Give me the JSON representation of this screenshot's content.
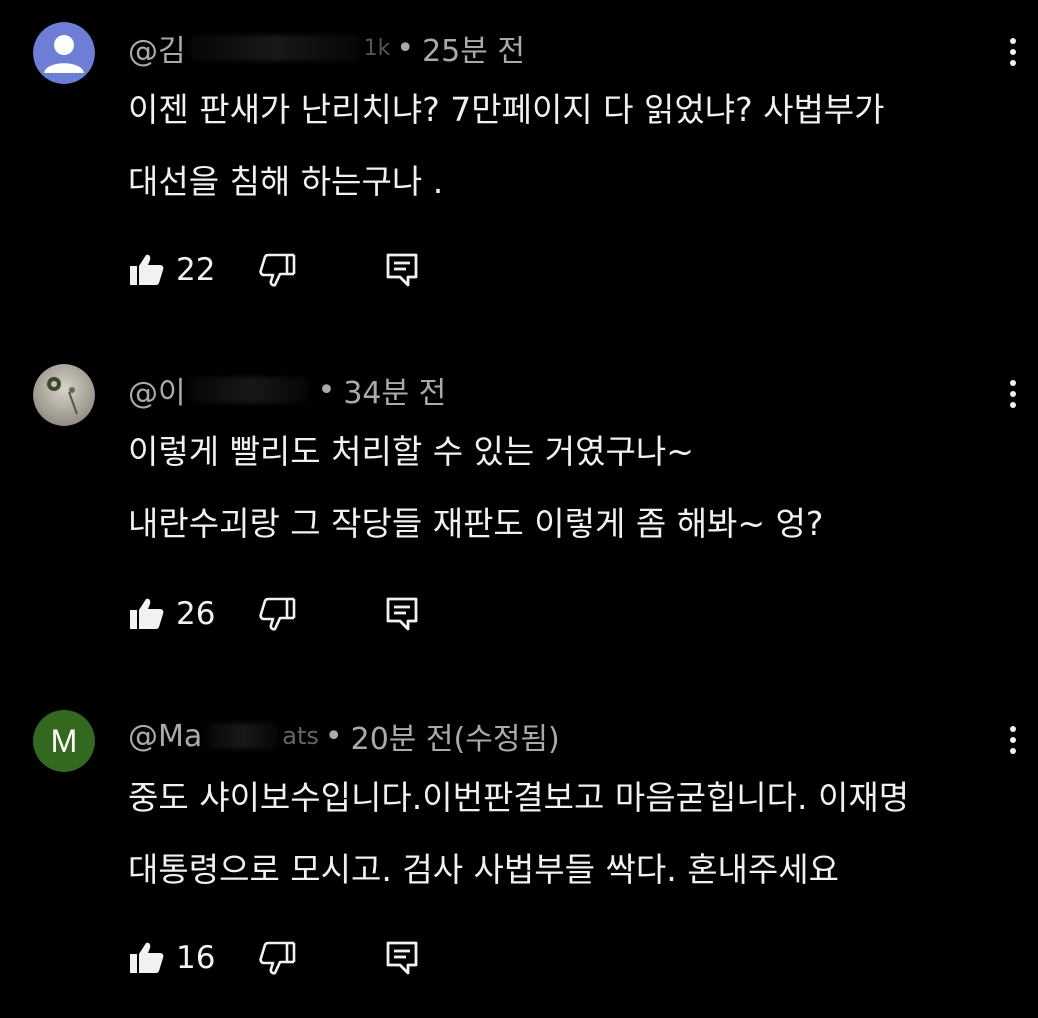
{
  "colors": {
    "background": "#000000",
    "text": "#f1f1f1",
    "meta": "#aaaaaa",
    "avatar_default": "#6d7ed6",
    "avatar_m": "#33691e"
  },
  "comments": [
    {
      "handle_visible": "@김",
      "handle_tail": "1k",
      "time": "25분 전",
      "lines": [
        "이젠 판새가 난리치냐? 7만페이지 다 읽었냐? 사법부가",
        "대선을 침해 하는구나 ."
      ],
      "likes": "22",
      "avatar": "default-person-icon"
    },
    {
      "handle_visible": "@이",
      "handle_tail": "",
      "time": "34분 전",
      "lines": [
        "이렇게 빨리도 처리할 수 있는 거였구나~",
        "내란수괴랑 그 작당들 재판도 이렇게 좀 해봐~ 엉?"
      ],
      "likes": "26",
      "avatar": "photo-avatar"
    },
    {
      "handle_visible": "@Ma",
      "handle_tail": "ats",
      "time": "20분 전(수정됨)",
      "lines": [
        "중도 샤이보수입니다.이번판결보고 마음굳힙니다. 이재명",
        "대통령으로 모시고. 검사 사법부들 싹다. 혼내주세요"
      ],
      "likes": "16",
      "avatar_letter": "M"
    }
  ],
  "icons": {
    "like": "thumbs-up-icon",
    "dislike": "thumbs-down-icon",
    "reply": "reply-icon",
    "menu": "more-vert-icon"
  }
}
